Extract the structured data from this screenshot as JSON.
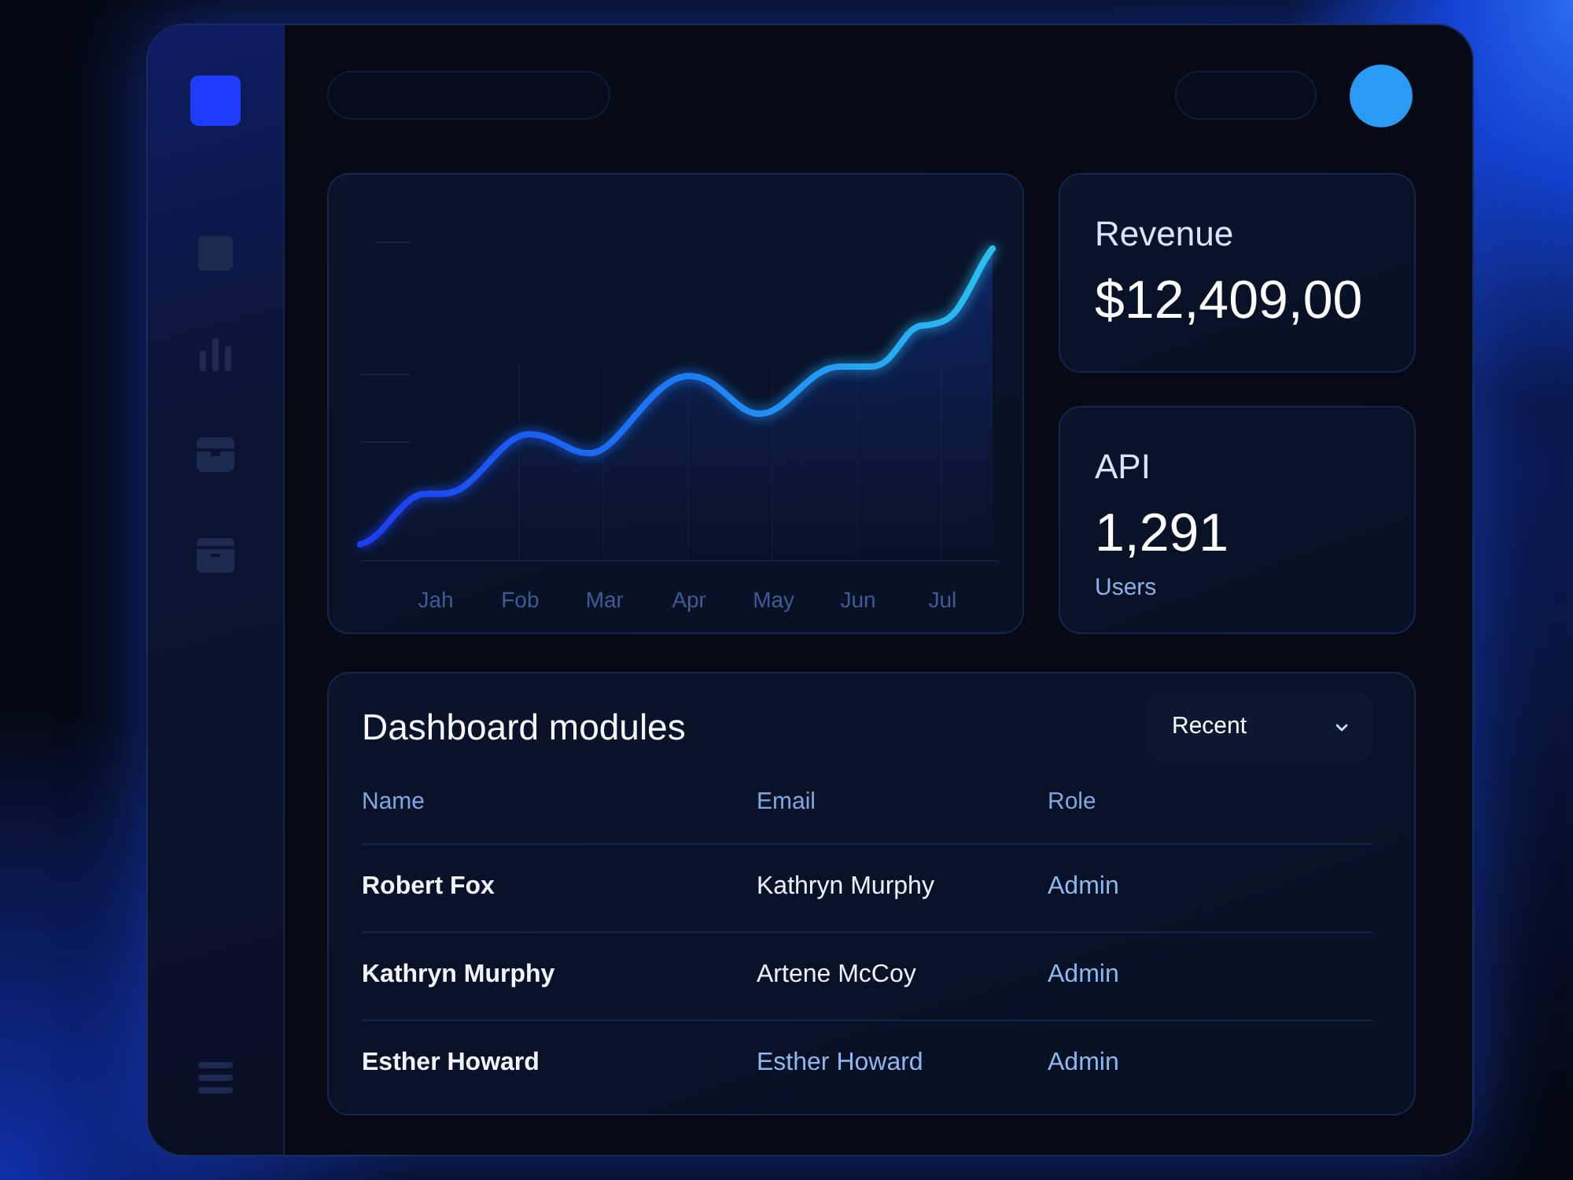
{
  "chart": {
    "x_labels": [
      "Jah",
      "Fob",
      "Mar",
      "Apr",
      "May",
      "Jun",
      "Jul"
    ]
  },
  "stats": [
    {
      "label": "Revenue",
      "value": "$12,409,00"
    },
    {
      "label": "API",
      "value": "1,291",
      "caption": "Users"
    }
  ],
  "table": {
    "title": "Dashboard modules",
    "filter": {
      "value": "Recent"
    },
    "columns": [
      "Name",
      "Email",
      "Role"
    ],
    "rows": [
      {
        "name": "Robert Fox",
        "email": "Kathryn Murphy",
        "role": "Admin",
        "email_highlighted": false
      },
      {
        "name": "Kathryn Murphy",
        "email": "Artene McCoy",
        "role": "Admin",
        "email_highlighted": false
      },
      {
        "name": "Esther Howard",
        "email": "Esther Howard",
        "role": "Admin",
        "email_highlighted": true
      }
    ]
  }
}
